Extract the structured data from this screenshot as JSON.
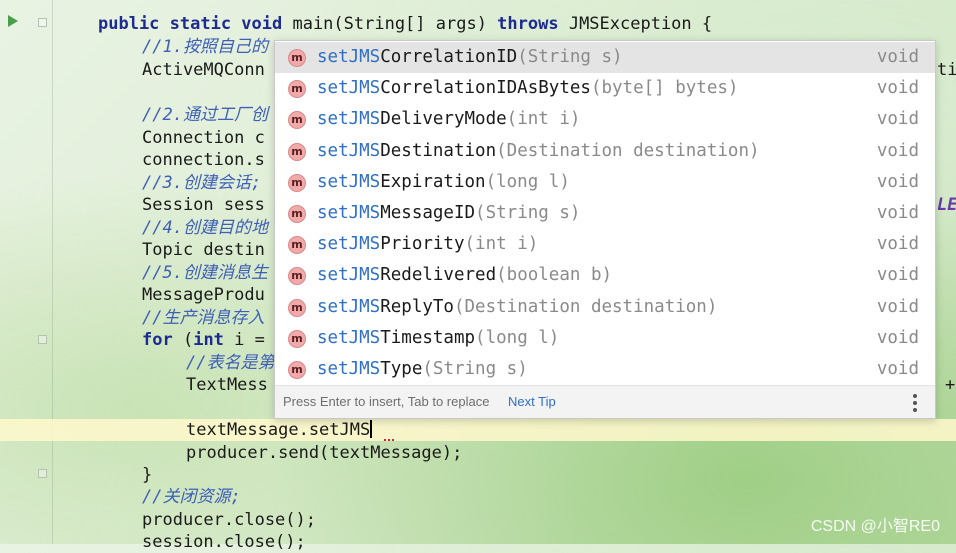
{
  "code": {
    "line1": {
      "kw1": "public static void",
      "rest1": " main(String[] args) ",
      "kw2": "throws",
      "rest2": " JMSException {"
    },
    "line2": "//1.按照自己的",
    "line3": "ActiveMQConn",
    "line3_right": "ti",
    "line4": "//2.通过工厂创",
    "line5": "Connection c",
    "line6": "connection.s",
    "line7": "//3.创建会话;",
    "line8": "Session sess",
    "line8_right": "LE",
    "line9": "//4.创建目的地",
    "line10": "Topic destin",
    "line11": "//5.创建消息生",
    "line12": "MessageProdu",
    "line13": "//生产消息存入",
    "line14": {
      "kw": "for",
      "mid": " (",
      "kw2": "int",
      "rest": " i ="
    },
    "line15": "//表名是第",
    "line16": "TextMess",
    "line16_right": "+",
    "current_line": "textMessage.setJMS",
    "line18": "producer.send(textMessage);",
    "line19": "}",
    "line20": "//关闭资源;",
    "line21": "producer.close();",
    "line22": "session.close();"
  },
  "popup": {
    "items": [
      {
        "match": "setJMS",
        "name": "CorrelationID",
        "params": "(String s)",
        "ret": "void",
        "selected": true
      },
      {
        "match": "setJMS",
        "name": "CorrelationIDAsBytes",
        "params": "(byte[] bytes)",
        "ret": "void"
      },
      {
        "match": "setJMS",
        "name": "DeliveryMode",
        "params": "(int i)",
        "ret": "void"
      },
      {
        "match": "setJMS",
        "name": "Destination",
        "params": "(Destination destination)",
        "ret": "void"
      },
      {
        "match": "setJMS",
        "name": "Expiration",
        "params": "(long l)",
        "ret": "void"
      },
      {
        "match": "setJMS",
        "name": "MessageID",
        "params": "(String s)",
        "ret": "void"
      },
      {
        "match": "setJMS",
        "name": "Priority",
        "params": "(int i)",
        "ret": "void"
      },
      {
        "match": "setJMS",
        "name": "Redelivered",
        "params": "(boolean b)",
        "ret": "void"
      },
      {
        "match": "setJMS",
        "name": "ReplyTo",
        "params": "(Destination destination)",
        "ret": "void"
      },
      {
        "match": "setJMS",
        "name": "Timestamp",
        "params": "(long l)",
        "ret": "void"
      },
      {
        "match": "setJMS",
        "name": "Type",
        "params": "(String s)",
        "ret": "void"
      }
    ],
    "icon_letter": "m",
    "hint": "Press Enter to insert, Tab to replace",
    "next_tip": "Next Tip"
  },
  "watermark": "CSDN @小智RE0",
  "icons": {
    "run": "run-arrow-icon",
    "method": "method-icon",
    "more": "more-vertical-icon"
  },
  "colors": {
    "match": "#2f6fc6",
    "keyword": "#1d2a8f",
    "comment": "#3e5fb8",
    "method_icon": "#f1a9a9"
  }
}
